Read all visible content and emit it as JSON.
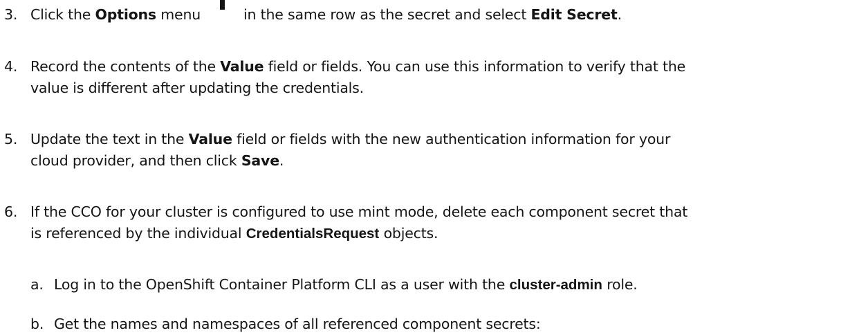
{
  "steps": [
    {
      "number": "3.",
      "segments": [
        {
          "text": "Click the ",
          "bold": false
        },
        {
          "text": "Options",
          "bold": true
        },
        {
          "text": " menu",
          "bold": false
        }
      ],
      "after_icon_text": "in the same row as the secret and select ",
      "after_icon_bold": "Edit Secret",
      "after_icon_end": ".",
      "icon": "kebab-options-icon"
    },
    {
      "number": "4.",
      "line1_pre": "Record the contents of the ",
      "line1_bold": "Value",
      "line1_post": " field or fields. You can use this information to verify that the",
      "line2": "value is different after updating the credentials."
    },
    {
      "number": "5.",
      "line1_pre": "Update the text in the ",
      "line1_bold": "Value",
      "line1_post": " field or fields with the new authentication information for your",
      "line2_pre": "cloud provider, and then click ",
      "line2_bold": "Save",
      "line2_post": "."
    },
    {
      "number": "6.",
      "line1": "If the CCO for your cluster is configured to use mint mode, delete each component secret that",
      "line2_pre": "is referenced by the individual ",
      "line2_bold": "CredentialsRequest",
      "line2_post": " objects."
    }
  ],
  "substeps": [
    {
      "number": "a.",
      "pre": "Log in to the OpenShift Container Platform CLI as a user with the ",
      "bold": "cluster-admin",
      "post": " role."
    },
    {
      "number": "b.",
      "text": "Get the names and namespaces of all referenced component secrets:"
    }
  ]
}
